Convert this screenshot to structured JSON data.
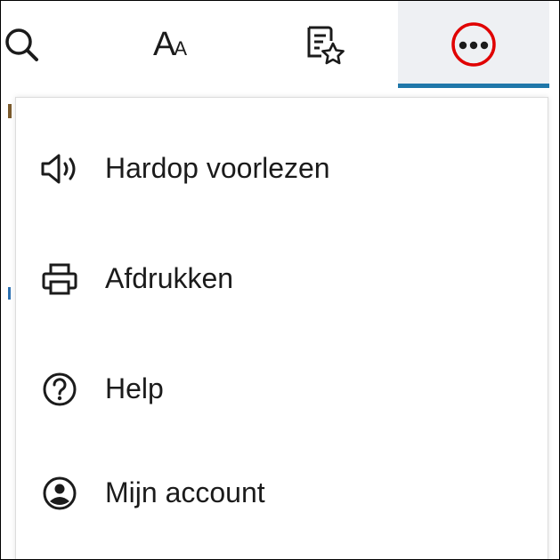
{
  "toolbar": {
    "search_icon": "search-icon",
    "font_label_big": "A",
    "font_label_small": "A",
    "favorites_icon": "star-list-icon",
    "more_icon": "more-dots-icon",
    "accent_color": "#1f77a9",
    "highlight_color": "#e00000"
  },
  "menu": {
    "items": [
      {
        "label": "Hardop voorlezen",
        "icon": "speaker-icon"
      },
      {
        "label": "Afdrukken",
        "icon": "printer-icon"
      },
      {
        "label": "Help",
        "icon": "help-icon"
      },
      {
        "label": "Mijn account",
        "icon": "account-icon"
      }
    ]
  }
}
